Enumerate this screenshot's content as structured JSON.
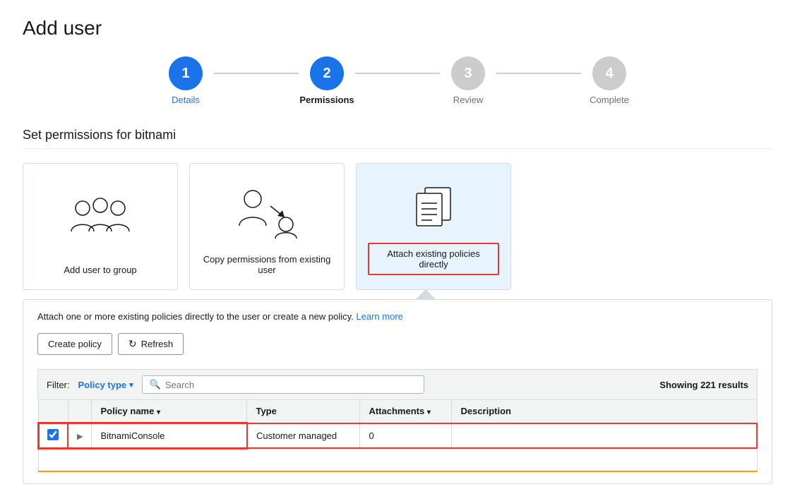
{
  "page": {
    "title": "Add user"
  },
  "stepper": {
    "steps": [
      {
        "number": "1",
        "label": "Details",
        "state": "active"
      },
      {
        "number": "2",
        "label": "Permissions",
        "state": "current"
      },
      {
        "number": "3",
        "label": "Review",
        "state": "inactive"
      },
      {
        "number": "4",
        "label": "Complete",
        "state": "inactive"
      }
    ]
  },
  "permissions_section": {
    "title": "Set permissions for bitnami",
    "cards": [
      {
        "id": "add-to-group",
        "label": "Add user to group",
        "selected": false
      },
      {
        "id": "copy-permissions",
        "label": "Copy permissions from existing user",
        "selected": false
      },
      {
        "id": "attach-policies",
        "label": "Attach existing policies directly",
        "selected": true
      }
    ]
  },
  "policy_panel": {
    "description": "Attach one or more existing policies directly to the user or create a new policy.",
    "learn_more": "Learn more",
    "buttons": {
      "create_policy": "Create policy",
      "refresh": "Refresh"
    },
    "filter": {
      "label": "Filter:",
      "type_label": "Policy type",
      "search_placeholder": "Search"
    },
    "results": {
      "count": "Showing 221 results"
    },
    "table": {
      "columns": [
        {
          "id": "check",
          "label": ""
        },
        {
          "id": "expand",
          "label": ""
        },
        {
          "id": "name",
          "label": "Policy name",
          "sortable": true
        },
        {
          "id": "type",
          "label": "Type",
          "sortable": false
        },
        {
          "id": "attachments",
          "label": "Attachments",
          "sortable": true
        },
        {
          "id": "description",
          "label": "Description",
          "sortable": false
        }
      ],
      "rows": [
        {
          "checked": true,
          "expanded": false,
          "name": "BitnamiConsole",
          "type": "Customer managed",
          "attachments": "0",
          "description": "",
          "highlighted": true
        }
      ]
    }
  }
}
